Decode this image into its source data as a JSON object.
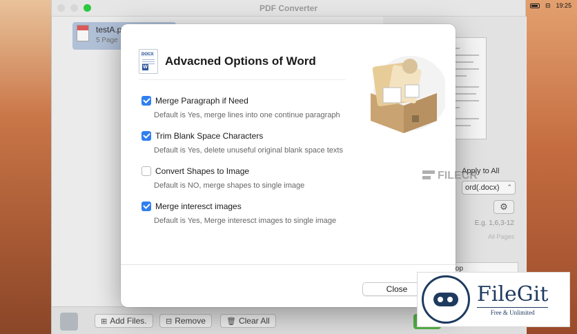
{
  "menubar": {
    "time": "19:25"
  },
  "window": {
    "title": "PDF Converter"
  },
  "file_list": {
    "items": [
      {
        "name": "testA.p",
        "pages": "5 Page"
      }
    ]
  },
  "right_panel": {
    "apply_all": "Apply to All",
    "format": "ord(.docx)",
    "page_range_placeholder": "E.g. 1,6,3-12",
    "all_pages": "All Pages",
    "output_path": "ktop"
  },
  "bottom_bar": {
    "add_files": "Add Files.",
    "remove": "Remove",
    "clear_all": "Clear All"
  },
  "dialog": {
    "title": "Advacned Options of Word",
    "icon_tag": "DOCX",
    "options": [
      {
        "label": "Merge Paragraph if Need",
        "checked": true,
        "desc": "Default is Yes, merge lines into one continue paragraph"
      },
      {
        "label": "Trim Blank Space Characters",
        "checked": true,
        "desc": "Default is Yes, delete unuseful original blank space texts"
      },
      {
        "label": "Convert Shapes to Image",
        "checked": false,
        "desc": "Default is NO, merge shapes to single image"
      },
      {
        "label": "Merge interesct images",
        "checked": true,
        "desc": "Default is Yes, Merge interesct images to single image"
      }
    ],
    "close_label": "Close"
  },
  "watermarks": {
    "filecr": "FILECR",
    "filegit_name": "FileGit",
    "filegit_sub": "Free & Unlimited"
  },
  "colors": {
    "accent": "#2f7ff0",
    "convert_green": "#58b94b",
    "brand_navy": "#1e3a5f"
  }
}
